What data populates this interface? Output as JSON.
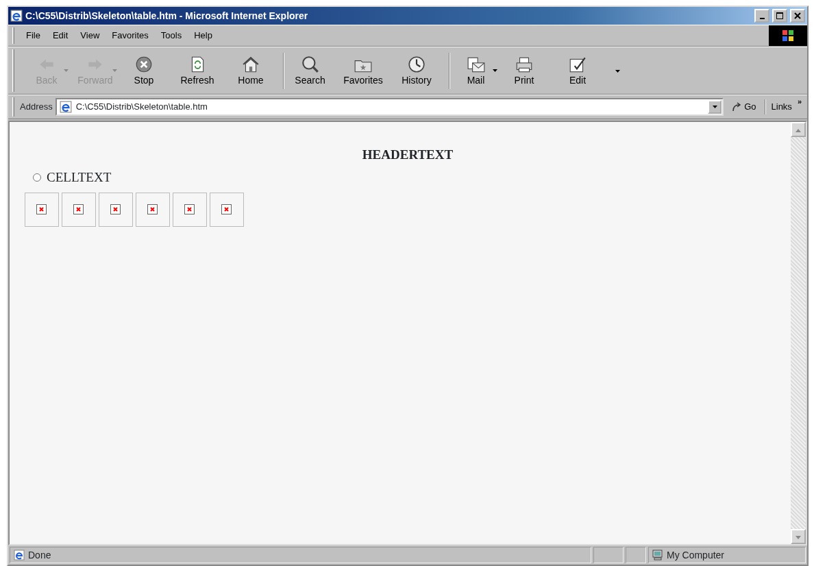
{
  "window": {
    "title": "C:\\C55\\Distrib\\Skeleton\\table.htm - Microsoft Internet Explorer"
  },
  "menu": [
    "File",
    "Edit",
    "View",
    "Favorites",
    "Tools",
    "Help"
  ],
  "toolbar": [
    {
      "label": "Back",
      "disabled": true,
      "dropdown": true,
      "separator_before": false
    },
    {
      "label": "Forward",
      "disabled": true,
      "dropdown": true,
      "separator_before": false
    },
    {
      "label": "Stop",
      "disabled": false,
      "dropdown": false,
      "separator_before": false
    },
    {
      "label": "Refresh",
      "disabled": false,
      "dropdown": false,
      "separator_before": false
    },
    {
      "label": "Home",
      "disabled": false,
      "dropdown": false,
      "separator_before": false
    },
    {
      "label": "Search",
      "disabled": false,
      "dropdown": false,
      "separator_before": true
    },
    {
      "label": "Favorites",
      "disabled": false,
      "dropdown": false,
      "separator_before": false
    },
    {
      "label": "History",
      "disabled": false,
      "dropdown": false,
      "separator_before": false
    },
    {
      "label": "Mail",
      "disabled": false,
      "dropdown": true,
      "separator_before": true
    },
    {
      "label": "Print",
      "disabled": false,
      "dropdown": false,
      "separator_before": false
    },
    {
      "label": "Edit",
      "disabled": false,
      "dropdown": false,
      "separator_before": false
    }
  ],
  "address": {
    "label": "Address",
    "value": "C:\\C55\\Distrib\\Skeleton\\table.htm",
    "go": "Go",
    "links": "Links",
    "links_more": "»"
  },
  "content": {
    "header": "HEADERTEXT",
    "radio": {
      "label": "CELLTEXT",
      "selected": false
    },
    "images": [
      {
        "kind": "broken"
      },
      {
        "kind": "broken"
      },
      {
        "kind": "broken"
      },
      {
        "kind": "broken"
      },
      {
        "kind": "broken"
      },
      {
        "kind": "broken"
      }
    ]
  },
  "status_bar": {
    "text": "Done",
    "zone": "My Computer"
  }
}
